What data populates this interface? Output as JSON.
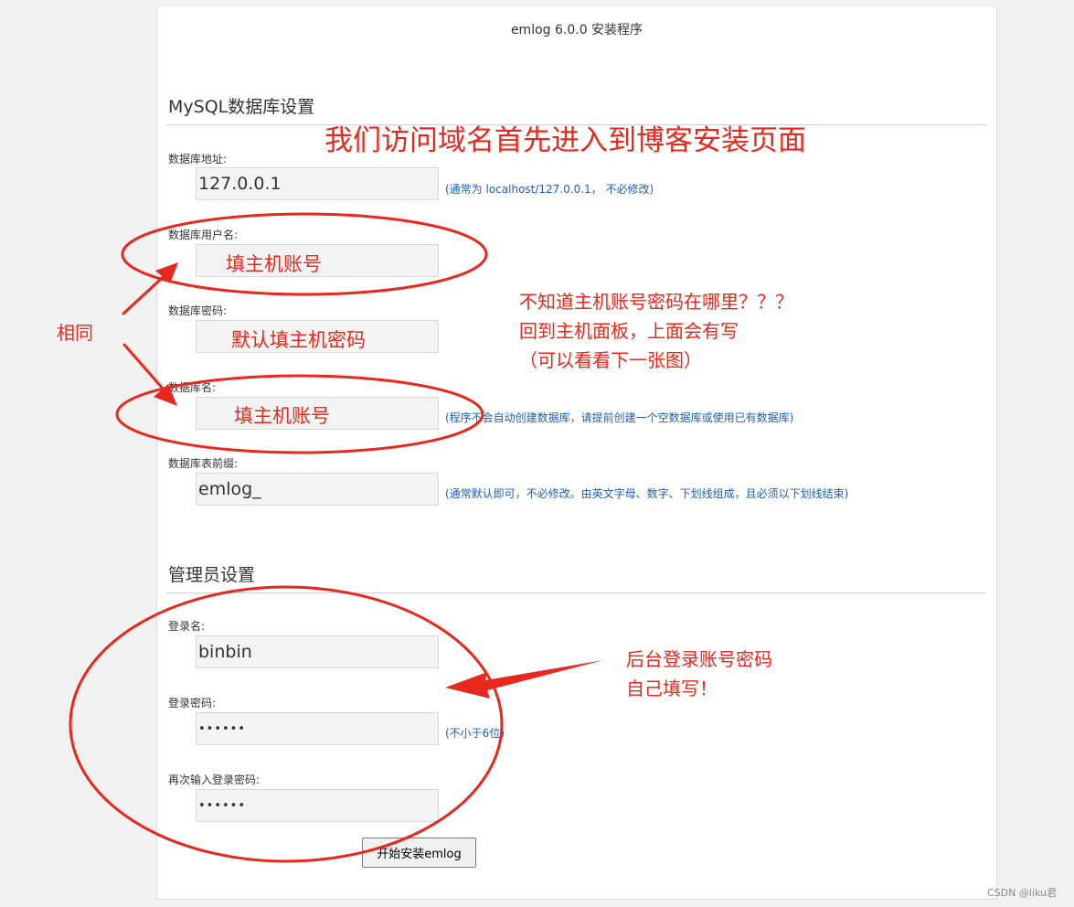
{
  "window": {
    "title": "emlog 6.0.0 安装程序"
  },
  "mysql_section": {
    "heading": "MySQL数据库设置",
    "fields": [
      {
        "label": "数据库地址:",
        "value": "127.0.0.1",
        "hint": "(通常为 localhost/127.0.0.1， 不必修改)"
      },
      {
        "label": "数据库用户名:",
        "value": "",
        "hint": ""
      },
      {
        "label": "数据库密码:",
        "value": "",
        "hint": ""
      },
      {
        "label": "数据库名:",
        "value": "",
        "hint": "(程序不会自动创建数据库，请提前创建一个空数据库或使用已有数据库)"
      },
      {
        "label": "数据库表前缀:",
        "value": "emlog_",
        "hint": "(通常默认即可，不必修改。由英文字母、数字、下划线组成，且必须以下划线结束)"
      }
    ]
  },
  "admin_section": {
    "heading": "管理员设置",
    "fields": [
      {
        "label": "登录名:",
        "value": "binbin",
        "hint": ""
      },
      {
        "label": "登录密码:",
        "value": "••••••",
        "hint": "(不小于6位)"
      },
      {
        "label": "再次输入登录密码:",
        "value": "••••••",
        "hint": ""
      }
    ]
  },
  "install_button": {
    "label": "开始安装emlog"
  },
  "annotations": {
    "headline": "我们访问域名首先进入到博客安装页面",
    "fill_username": "填主机账号",
    "fill_password": "默认填主机密码",
    "fill_dbname": "填主机账号",
    "same": "相同",
    "note_lines": [
      "不知道主机账号密码在哪里？？？",
      "回到主机面板，上面会有写",
      "（可以看看下一张图）"
    ],
    "login_lines": [
      "后台登录账号密码",
      "自己填写！"
    ],
    "color": "#e8281e"
  },
  "watermark": "CSDN @liku君"
}
